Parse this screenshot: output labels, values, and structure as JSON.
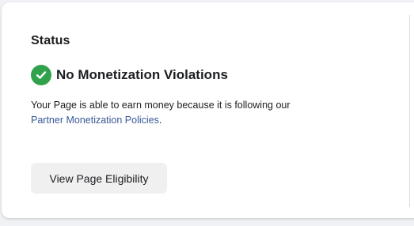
{
  "status": {
    "heading": "Status",
    "title": "No Monetization Violations",
    "icon": "check-circle-icon",
    "icon_color": "#31a24c"
  },
  "description": {
    "text_before": "Your Page is able to earn money because it is following our",
    "link_text": "Partner Monetization Policies",
    "text_after": ".",
    "link_color": "#385898"
  },
  "actions": {
    "view_eligibility_label": "View Page Eligibility"
  }
}
